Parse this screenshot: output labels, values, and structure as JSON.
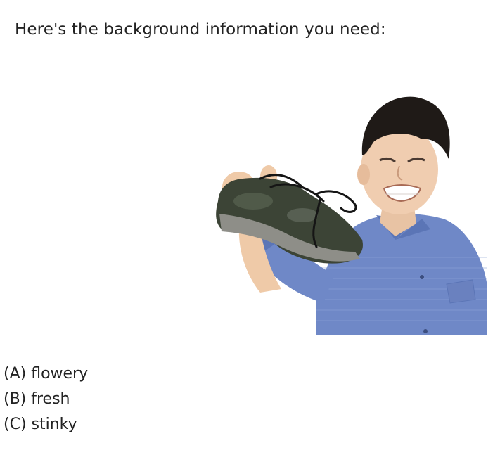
{
  "intro_text": "Here's the background information you need:",
  "photo": {
    "icon": "boy-holding-smelly-shoe"
  },
  "choices": [
    "(A) flowery",
    "(B) fresh",
    "(C) stinky"
  ]
}
